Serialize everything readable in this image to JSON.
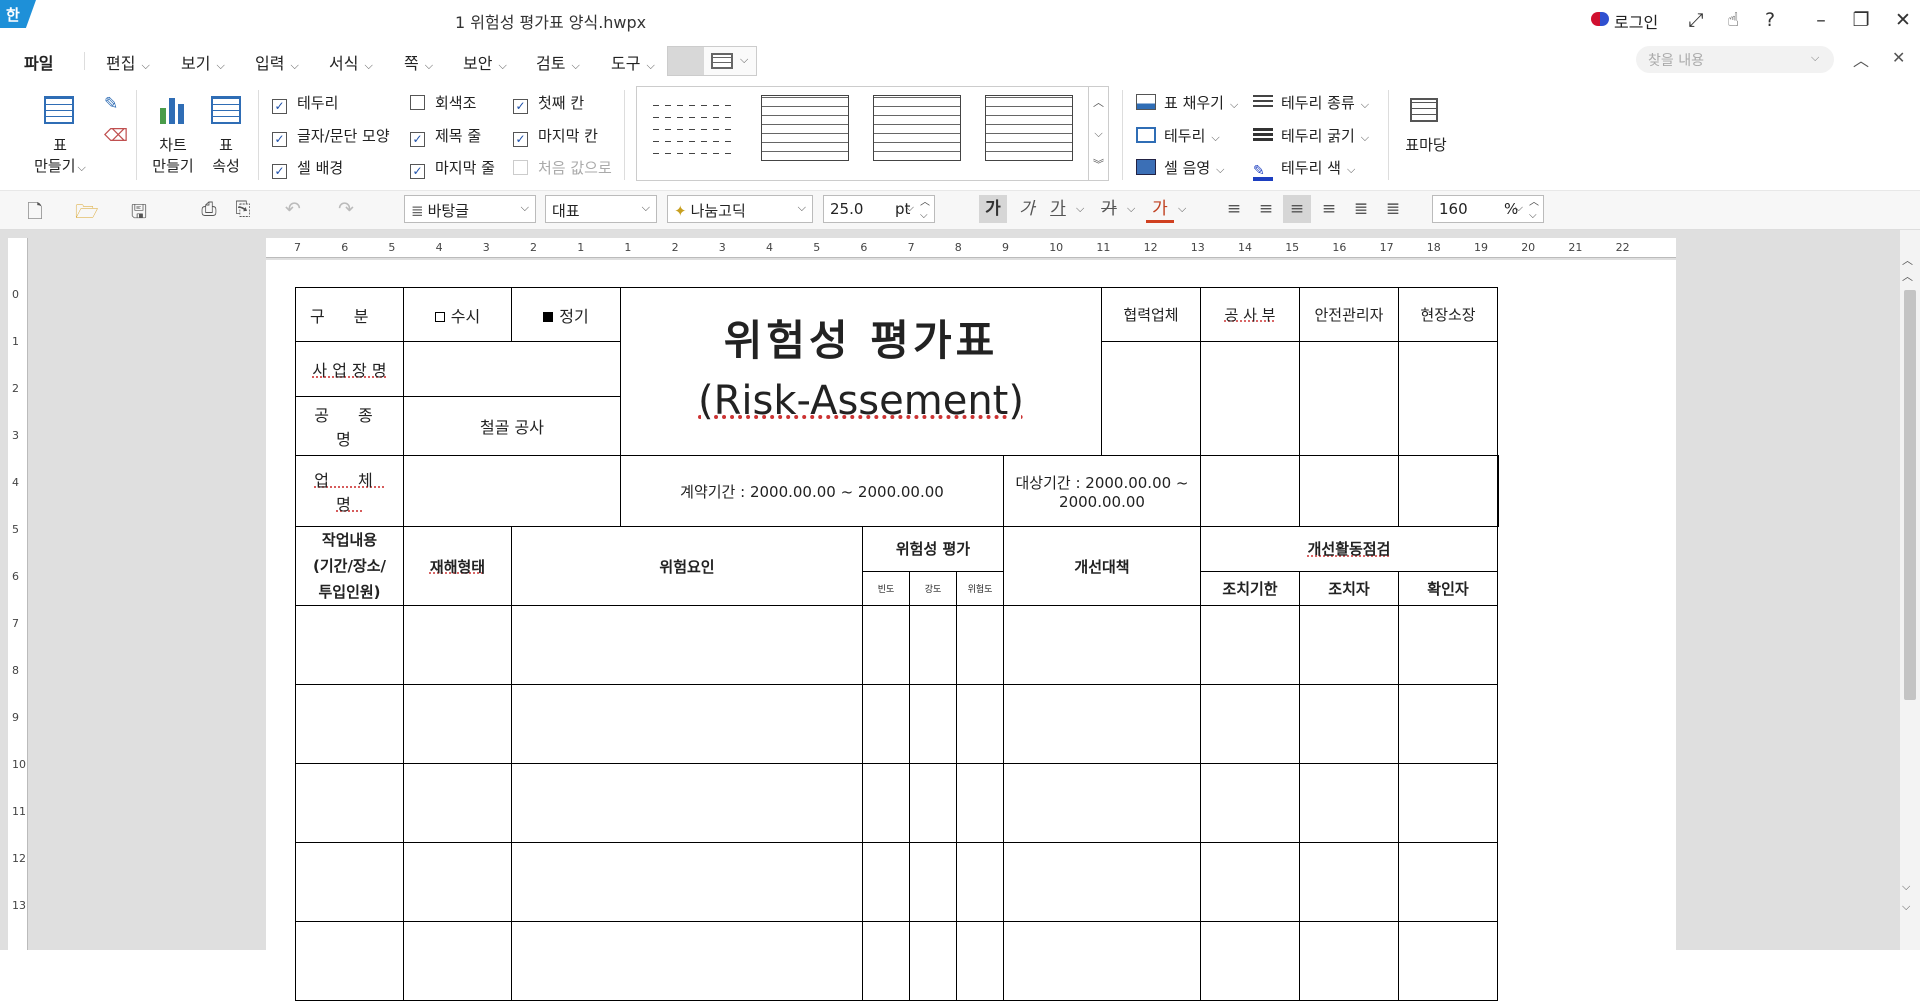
{
  "window": {
    "logo": "한",
    "title": "1 위험성 평가표 양식.hwpx",
    "login": "로그인"
  },
  "menu": {
    "file": "파일",
    "items": [
      "편집",
      "보기",
      "입력",
      "서식",
      "쪽",
      "보안",
      "검토",
      "도구"
    ],
    "search_placeholder": "찾을 내용"
  },
  "ribbon": {
    "table_make": [
      "표",
      "만들기"
    ],
    "chart_make": [
      "차트",
      "만들기"
    ],
    "table_props": [
      "표",
      "속성"
    ],
    "checks": [
      {
        "label": "테두리",
        "checked": true
      },
      {
        "label": "글자/문단 모양",
        "checked": true
      },
      {
        "label": "셀 배경",
        "checked": true
      },
      {
        "label": "회색조",
        "checked": false
      },
      {
        "label": "제목 줄",
        "checked": true
      },
      {
        "label": "마지막 줄",
        "checked": true
      },
      {
        "label": "첫째 칸",
        "checked": true
      },
      {
        "label": "마지막 칸",
        "checked": true
      },
      {
        "label": "처음 값으로",
        "checked": false
      }
    ],
    "fill": "표 채우기",
    "border": "테두리",
    "shade": "셀 음영",
    "border_type": "테두리 종류",
    "border_width": "테두리 굵기",
    "border_color": "테두리 색",
    "table_yard": "표마당"
  },
  "toolbar": {
    "style": "바탕글",
    "lang": "대표",
    "font": "나눔고딕",
    "size": "25.0",
    "unit": "pt",
    "zoom": "160",
    "zoom_unit": "%",
    "bold": "가",
    "italic": "가",
    "underline": "가",
    "strike": "가",
    "color": "가"
  },
  "ruler": {
    "h": [
      "7",
      "6",
      "5",
      "4",
      "3",
      "2",
      "1",
      "1",
      "2",
      "3",
      "4",
      "5",
      "6",
      "7",
      "8",
      "9",
      "10",
      "11",
      "12",
      "13",
      "14",
      "15",
      "16",
      "17",
      "18",
      "19",
      "20",
      "21",
      "22"
    ],
    "v": [
      "0",
      "1",
      "2",
      "3",
      "4",
      "5",
      "6",
      "7",
      "8",
      "9",
      "10",
      "11",
      "12",
      "13"
    ]
  },
  "table": {
    "gubun": "구 분",
    "susi": "수시",
    "jeonggi": "정기",
    "title_ko": "위험성 평가표",
    "title_en": "(Risk-Assement)",
    "approvals": [
      "협력업체",
      "공 사 부",
      "안전관리자",
      "현장소장"
    ],
    "site_name": "사 업 장 명",
    "work_type": "공 종 명",
    "work_type_val": "철골 공사",
    "company": "업 체 명",
    "contract": "계약기간 : 2000.00.00 ~ 2000.00.00",
    "target": "대상기간 : 2000.00.00 ~ 2000.00.00",
    "h_work": "작업내용\n(기간/장소/\n투입인원)",
    "h_disaster": "재해형태",
    "h_factor": "위험요인",
    "h_risk": "위험성 평가",
    "h_freq": "빈도",
    "h_sev": "강도",
    "h_risklv": "위험도",
    "h_measure": "개선대책",
    "h_check": "개선활동점검",
    "h_due": "조치기한",
    "h_person": "조치자",
    "h_confirm": "확인자"
  }
}
